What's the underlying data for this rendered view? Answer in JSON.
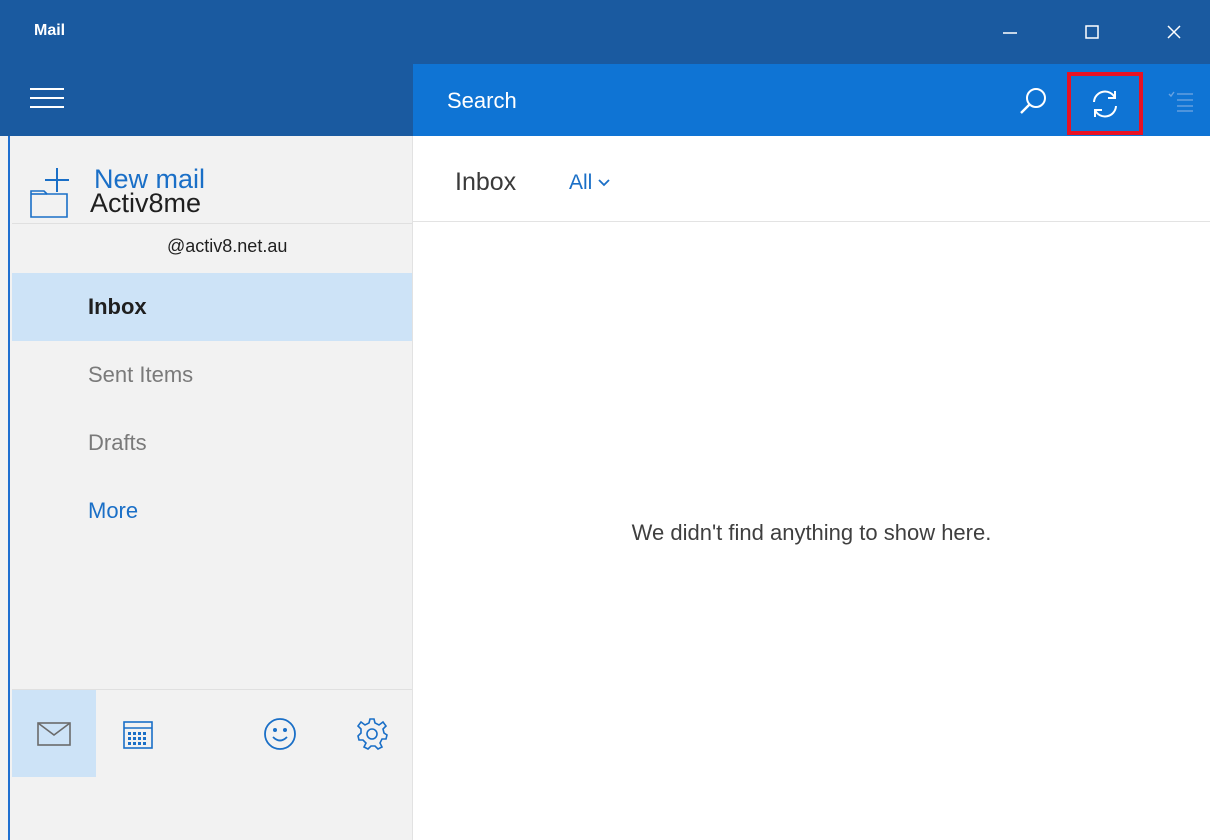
{
  "window": {
    "title": "Mail",
    "controls": {
      "minimize": "minimize-icon",
      "maximize": "maximize-icon",
      "close": "close-icon"
    }
  },
  "toolbar": {
    "search_placeholder": "Search",
    "icons": [
      "search-icon",
      "sync-icon",
      "select-mode-icon"
    ],
    "highlight_color": "#e81123"
  },
  "sidebar": {
    "new_mail_label": "New mail",
    "account": {
      "name": "Activ8me",
      "email": "@activ8.net.au"
    },
    "folders": [
      {
        "label": "Inbox",
        "selected": true
      },
      {
        "label": "Sent Items",
        "selected": false
      },
      {
        "label": "Drafts",
        "selected": false
      }
    ],
    "more_label": "More",
    "bottom_icons": [
      "mail-icon",
      "calendar-icon",
      "feedback-smiley-icon",
      "settings-gear-icon"
    ]
  },
  "content": {
    "title": "Inbox",
    "filter_label": "All",
    "empty_message": "We didn't find anything to show here."
  },
  "colors": {
    "title_bar": "#1a5aa0",
    "header": "#0f74d4",
    "accent": "#1a6fc7",
    "selected": "#cde3f7"
  }
}
